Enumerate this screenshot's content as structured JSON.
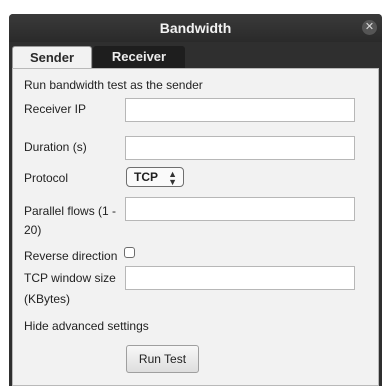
{
  "window": {
    "title": "Bandwidth",
    "close_glyph": "✕"
  },
  "tabs": [
    {
      "label": "Sender",
      "active": true
    },
    {
      "label": "Receiver",
      "active": false
    }
  ],
  "form": {
    "heading": "Run bandwidth test as the sender",
    "receiver_ip": {
      "label": "Receiver IP",
      "value": ""
    },
    "duration": {
      "label": "Duration (s)",
      "value": ""
    },
    "protocol": {
      "label": "Protocol",
      "selected": "TCP"
    },
    "parallel_flows": {
      "label_line1": "Parallel flows (1 -",
      "label_line2": "20)",
      "value": ""
    },
    "reverse_direction": {
      "label": "Reverse direction",
      "checked": false
    },
    "tcp_window": {
      "label_line1": "TCP window size",
      "label_line2": "(KBytes)",
      "value": ""
    },
    "advanced_toggle": "Hide advanced settings",
    "run_button": "Run Test"
  }
}
